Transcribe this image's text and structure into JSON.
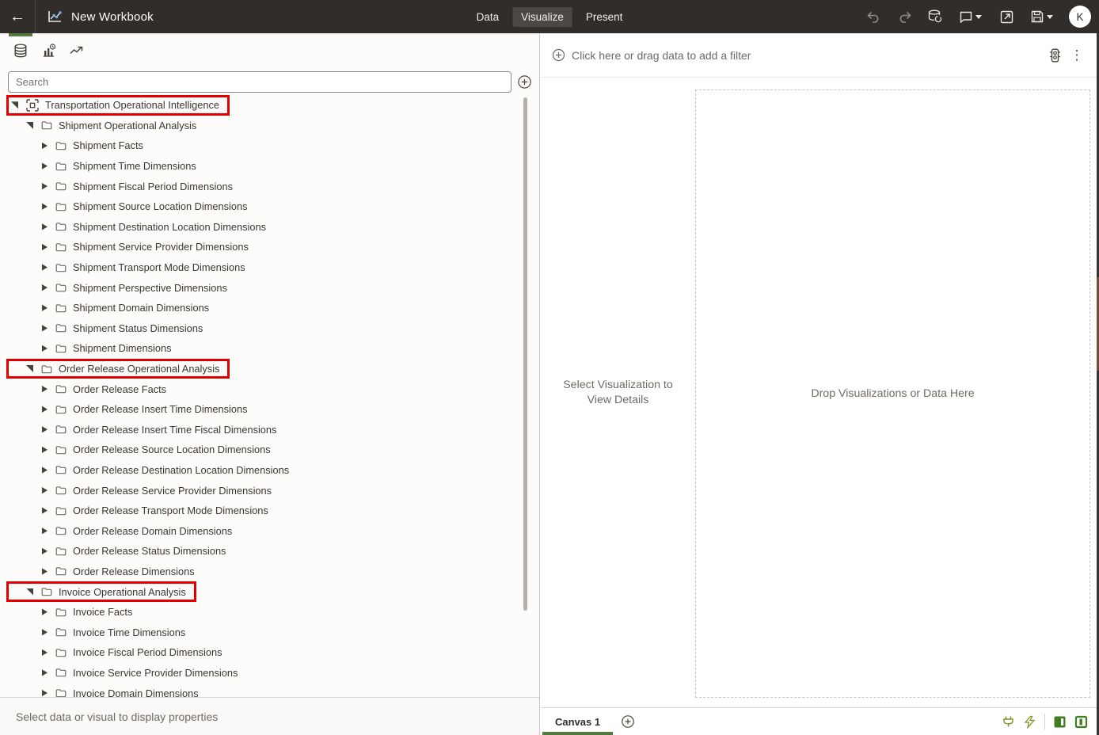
{
  "app": {
    "title": "New Workbook"
  },
  "topbar": {
    "tabs": [
      {
        "label": "Data",
        "active": false
      },
      {
        "label": "Visualize",
        "active": true
      },
      {
        "label": "Present",
        "active": false
      }
    ],
    "avatar_initial": "K"
  },
  "left_panel": {
    "search_placeholder": "Search",
    "status_text": "Select data or visual to display properties",
    "tree": [
      {
        "label": "Transportation Operational Intelligence",
        "level": 0,
        "state": "expanded",
        "icon": "subject-area",
        "highlighted": true
      },
      {
        "label": "Shipment Operational Analysis",
        "level": 1,
        "state": "expanded",
        "icon": "folder",
        "highlighted": false
      },
      {
        "label": "Shipment Facts",
        "level": 2,
        "state": "collapsed",
        "icon": "folder",
        "highlighted": false
      },
      {
        "label": "Shipment Time Dimensions",
        "level": 2,
        "state": "collapsed",
        "icon": "folder",
        "highlighted": false
      },
      {
        "label": "Shipment Fiscal Period Dimensions",
        "level": 2,
        "state": "collapsed",
        "icon": "folder",
        "highlighted": false
      },
      {
        "label": "Shipment Source Location Dimensions",
        "level": 2,
        "state": "collapsed",
        "icon": "folder",
        "highlighted": false
      },
      {
        "label": "Shipment Destination Location Dimensions",
        "level": 2,
        "state": "collapsed",
        "icon": "folder",
        "highlighted": false
      },
      {
        "label": "Shipment Service Provider Dimensions",
        "level": 2,
        "state": "collapsed",
        "icon": "folder",
        "highlighted": false
      },
      {
        "label": "Shipment Transport Mode Dimensions",
        "level": 2,
        "state": "collapsed",
        "icon": "folder",
        "highlighted": false
      },
      {
        "label": "Shipment Perspective Dimensions",
        "level": 2,
        "state": "collapsed",
        "icon": "folder",
        "highlighted": false
      },
      {
        "label": "Shipment Domain Dimensions",
        "level": 2,
        "state": "collapsed",
        "icon": "folder",
        "highlighted": false
      },
      {
        "label": "Shipment Status Dimensions",
        "level": 2,
        "state": "collapsed",
        "icon": "folder",
        "highlighted": false
      },
      {
        "label": "Shipment Dimensions",
        "level": 2,
        "state": "collapsed",
        "icon": "folder",
        "highlighted": false
      },
      {
        "label": "Order Release Operational Analysis",
        "level": 1,
        "state": "expanded",
        "icon": "folder",
        "highlighted": true
      },
      {
        "label": "Order Release Facts",
        "level": 2,
        "state": "collapsed",
        "icon": "folder",
        "highlighted": false
      },
      {
        "label": "Order Release Insert Time Dimensions",
        "level": 2,
        "state": "collapsed",
        "icon": "folder",
        "highlighted": false
      },
      {
        "label": "Order Release Insert Time Fiscal Dimensions",
        "level": 2,
        "state": "collapsed",
        "icon": "folder",
        "highlighted": false
      },
      {
        "label": "Order Release Source Location Dimensions",
        "level": 2,
        "state": "collapsed",
        "icon": "folder",
        "highlighted": false
      },
      {
        "label": "Order Release Destination Location Dimensions",
        "level": 2,
        "state": "collapsed",
        "icon": "folder",
        "highlighted": false
      },
      {
        "label": "Order Release Service Provider Dimensions",
        "level": 2,
        "state": "collapsed",
        "icon": "folder",
        "highlighted": false
      },
      {
        "label": "Order Release Transport Mode Dimensions",
        "level": 2,
        "state": "collapsed",
        "icon": "folder",
        "highlighted": false
      },
      {
        "label": "Order Release Domain Dimensions",
        "level": 2,
        "state": "collapsed",
        "icon": "folder",
        "highlighted": false
      },
      {
        "label": "Order Release Status Dimensions",
        "level": 2,
        "state": "collapsed",
        "icon": "folder",
        "highlighted": false
      },
      {
        "label": "Order Release Dimensions",
        "level": 2,
        "state": "collapsed",
        "icon": "folder",
        "highlighted": false
      },
      {
        "label": "Invoice Operational Analysis",
        "level": 1,
        "state": "expanded",
        "icon": "folder",
        "highlighted": true
      },
      {
        "label": "Invoice Facts",
        "level": 2,
        "state": "collapsed",
        "icon": "folder",
        "highlighted": false
      },
      {
        "label": "Invoice Time Dimensions",
        "level": 2,
        "state": "collapsed",
        "icon": "folder",
        "highlighted": false
      },
      {
        "label": "Invoice Fiscal Period Dimensions",
        "level": 2,
        "state": "collapsed",
        "icon": "folder",
        "highlighted": false
      },
      {
        "label": "Invoice Service Provider Dimensions",
        "level": 2,
        "state": "collapsed",
        "icon": "folder",
        "highlighted": false
      },
      {
        "label": "Invoice Domain Dimensions",
        "level": 2,
        "state": "collapsed",
        "icon": "folder",
        "highlighted": false
      }
    ]
  },
  "right_panel": {
    "filter_bar": {
      "prompt": "Click here or drag data to add a filter"
    },
    "canvas": {
      "left_hint": "Select Visualization to View Details",
      "drop_hint": "Drop Visualizations or Data Here"
    },
    "bottom_bar": {
      "canvas_tab_label": "Canvas 1"
    }
  },
  "colors": {
    "topbar_bg": "#312d2a",
    "accent_green": "#55783f",
    "toggle_green": "#3f7d22",
    "olive_icon": "#849126",
    "annotation_red": "#e10000"
  }
}
